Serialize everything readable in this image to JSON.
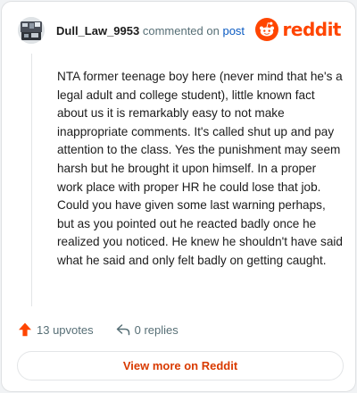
{
  "header": {
    "username": "Dull_Law_9953",
    "commented_on_text": "commented on",
    "post_link": "post",
    "brand_name": "reddit",
    "avatar_icon": "user-avatar-icon",
    "brand_icon": "reddit-logo-icon"
  },
  "comment": {
    "text": "NTA former teenage boy here (never mind that he's a legal adult and college student), little known fact about us it is remarkably easy to not make inappropriate comments. It's called shut up and pay attention to the class. Yes the punishment may seem harsh but he brought it upon himself. In a proper work place with proper HR he could lose that job. Could you have given some last warning perhaps, but as you pointed out he reacted badly once he realized you noticed. He knew he shouldn't have said what he said and only felt badly on getting caught."
  },
  "actions": {
    "upvotes_label": "13 upvotes",
    "replies_label": "0 replies",
    "upvote_icon": "upvote-arrow-icon",
    "reply_icon": "reply-arrow-icon"
  },
  "cta": {
    "label": "View more on Reddit"
  },
  "colors": {
    "brand": "#ff4500",
    "link": "#0a5ac2",
    "cta_text": "#d93a00",
    "muted": "#576f76"
  }
}
